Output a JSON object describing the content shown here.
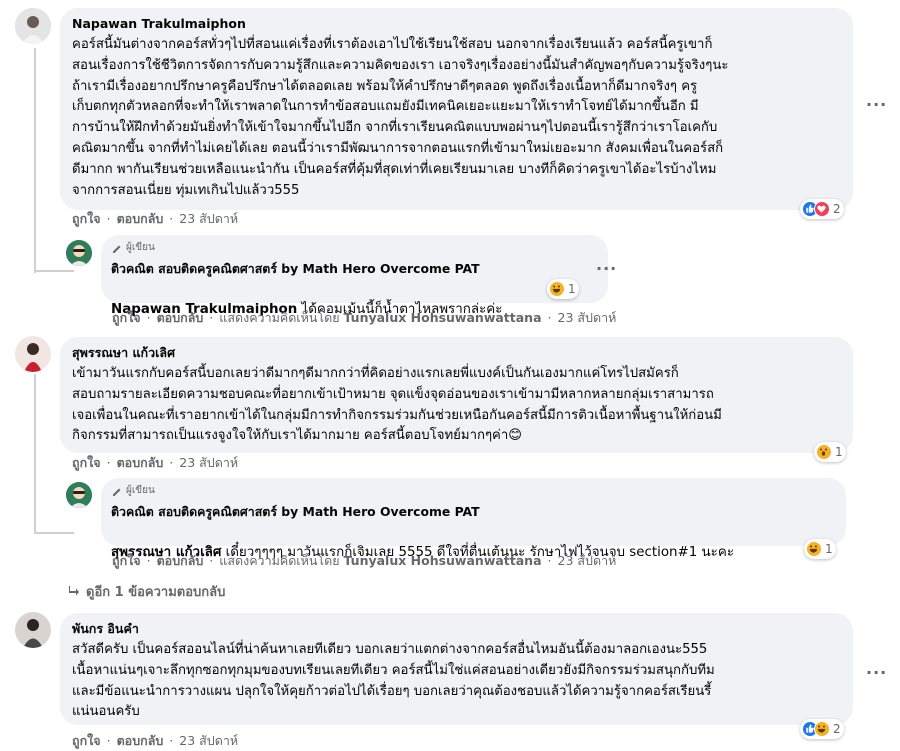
{
  "comments": [
    {
      "author": "Napawan Trakulmaiphon",
      "text": "คอร์สนี้มันต่างจากคอร์สทั่วๆไปที่สอนแค่เรื่องที่เราต้องเอาไปใช้เรียนใช้สอบ นอกจากเรื่องเรียนแล้ว คอร์สนี้ครูเขาก็\nสอนเรื่องการใช้ชีวิตการจัดการกับความรู้สึกและความคิดของเรา เอาจริงๆเรื่องอย่างนี้มันสำคัญพอๆกับความรู้จริงๆนะ\nถ้าเรามีเรื่องอยากปรึกษาครูคือปรึกษาได้ตลอดเลย พร้อมให้คำปรึกษาดีๆตลอด พูดถึงเรื่องเนื้อหาก็ดีมากจริงๆ ครู\nเก็บตกทุกตัวหลอกที่จะทำให้เราพลาดในการทำข้อสอบแถมยังมีเทคนิคเยอะแยะมาให้เราทำโจทย์ได้มากขึ้นอีก มี\nการบ้านให้ฝึกทำด้วยมันยิ่งทำให้เข้าใจมากขึ้นไปอีก จากที่เราเรียนคณิตแบบพอผ่านๆไปตอนนี้เรารู้สึกว่าเราโอเคกับ\nคณิตมากขึ้น จากที่ทำไม่เคยได้เลย ตอนนี้ว่าเรามีพัฒนาการจากตอนแรกที่เข้ามาใหม่เยอะมาก สังคมเพื่อนในคอร์สก็\nดีมากก พากันเรียนช่วยเหลือแนะนำกัน เป็นคอร์สที่คุ้มที่สุดเท่าที่เคยเรียนมาเลย บางทีก็คิดว่าครูเขาได้อะไรบ้างไหม\nจากการสอนเนี่ยย ทุ่มเทเกินไปแล้วว555",
      "like_label": "ถูกใจ",
      "reply_label": "ตอบกลับ",
      "time": "23 สัปดาห์",
      "reaction_count": "2"
    },
    {
      "author": "สุพรรณษา แก้วเลิศ",
      "text": "เข้ามาวันแรกกับคอร์สนี้บอกเลยว่าดีมากๆดีมากกว่าที่คิดอย่างแรกเลยพี่แบงค์เป็นกันเองมากแค่โทรไปสมัครก็\nสอบถามรายละเอียดความชอบคณะที่อยากเข้าเป้าหมาย จุดแข็งจุดอ่อนของเราเข้ามามีหลากหลายกลุ่มเราสามารถ\nเจอเพื่อนในคณะที่เราอยากเข้าได้ในกลุ่มมีการทำกิจกรรมร่วมกันช่วยเหนือกันคอร์สนี้มีการติวเนื้อหาพื้นฐานให้ก่อนมี\nกิจกรรมที่สามารถเป็นแรงจูงใจให้กับเราได้มากมาย คอร์สนี้ตอบโจทย์มากๆค่า😊",
      "like_label": "ถูกใจ",
      "reply_label": "ตอบกลับ",
      "time": "23 สัปดาห์",
      "reaction_count": "1"
    },
    {
      "author": "พันกร อินคำ",
      "text": "สวัสดีครับ เป็นคอร์สออนไลน์ที่น่าค้นหาเลยทีเดียว บอกเลยว่าแตกต่างจากคอร์สอื่นไหมอันนี้ต้องมาลอกเองนะ555\nเนื้อหาแน่นๆเจาะลึกทุกซอกทุกมุมของบทเรียนเลยทีเดียว คอร์สนี้ไม่ใช่แค่สอนอย่างเดียวยังมีกิจกรรมร่วมสนุกกับทีม\nและมีข้อแนะนำการวางแผน ปลุกใจให้คุยก้าวต่อไปได้เรื่อยๆ บอกเลยว่าคุณต้องชอบแล้วได้ความรู้จากคอร์สเรียนรี้\nแน่นอนครับ",
      "like_label": "ถูกใจ",
      "reply_label": "ตอบกลับ",
      "time": "23 สัปดาห์",
      "reaction_count": "2"
    }
  ],
  "replies": [
    {
      "badge": "ผู้เขียน",
      "author": "ติวคณิต สอบติดครูคณิตศาสตร์ by Math Hero Overcome PAT",
      "tag": "Napawan Trakulmaiphon",
      "text": " ได้คอมเม้นนี้ก็น้ำตาไหลพรากล่ะค่ะ",
      "like_label": "ถูกใจ",
      "reply_label": "ตอบกลับ",
      "shown_by_label": "แสดงความคิดเห็นโดย",
      "shown_by": "Tunyalux Hohsuwanwattana",
      "time": "23 สัปดาห์",
      "reaction_count": "1"
    },
    {
      "badge": "ผู้เขียน",
      "author": "ติวคณิต สอบติดครูคณิตศาสตร์ by Math Hero Overcome PAT",
      "tag": "สุพรรณษา แก้วเลิศ",
      "text": " เดี๋ยวๆๆๆๆ มาวันแรกก็เจิมเลย 5555 ดีใจที่ตื่นเต้นนะ รักษาไฟไว้จนจบ section#1 นะคะ",
      "like_label": "ถูกใจ",
      "reply_label": "ตอบกลับ",
      "shown_by_label": "แสดงความคิดเห็นโดย",
      "shown_by": "Tunyalux Hohsuwanwattana",
      "time": "23 สัปดาห์",
      "reaction_count": "1"
    }
  ],
  "more_replies_label": "ดูอีก 1 ข้อความตอบกลับ",
  "more_icon_text": "···",
  "colors": {
    "bubble": "#f0f2f5",
    "secondary_text": "#65676b",
    "like_blue": "#1877f2",
    "love_red": "#f33e58",
    "emoji_yellow": "#f7b125"
  }
}
